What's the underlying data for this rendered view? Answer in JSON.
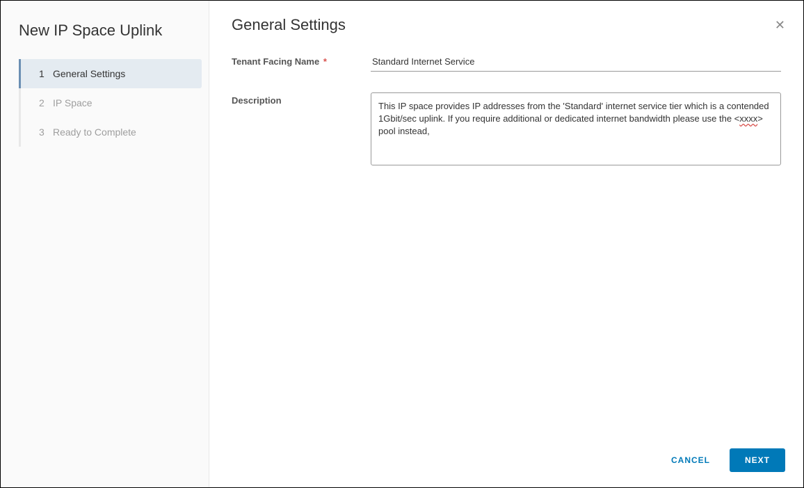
{
  "sidebar": {
    "title": "New IP Space Uplink",
    "steps": [
      {
        "num": "1",
        "label": "General Settings",
        "active": true
      },
      {
        "num": "2",
        "label": "IP Space",
        "active": false
      },
      {
        "num": "3",
        "label": "Ready to Complete",
        "active": false
      }
    ]
  },
  "main": {
    "title": "General Settings",
    "close_icon": "✕",
    "fields": {
      "tenant_name_label": "Tenant Facing Name",
      "tenant_name_required": "*",
      "tenant_name_value": "Standard Internet Service",
      "description_label": "Description",
      "description_value_pre": "This IP space provides IP addresses from the 'Standard' internet service tier which is a contended 1Gbit/sec uplink. If you require additional or dedicated internet bandwidth please use the <",
      "description_value_err": "xxxx",
      "description_value_post": "> pool instead,"
    }
  },
  "footer": {
    "cancel_label": "CANCEL",
    "next_label": "NEXT"
  }
}
